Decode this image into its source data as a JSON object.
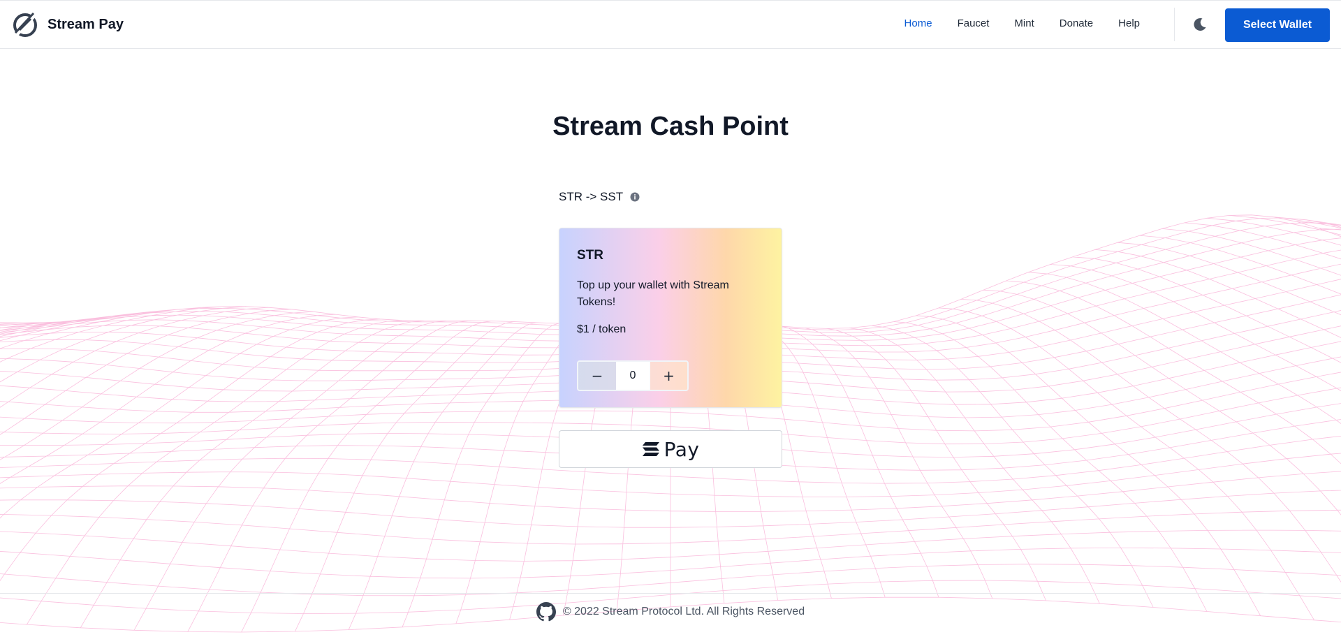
{
  "header": {
    "brand": "Stream Pay",
    "nav": [
      {
        "label": "Home",
        "active": true
      },
      {
        "label": "Faucet",
        "active": false
      },
      {
        "label": "Mint",
        "active": false
      },
      {
        "label": "Donate",
        "active": false
      },
      {
        "label": "Help",
        "active": false
      }
    ],
    "theme_icon": "moon-icon",
    "wallet_button": "Select Wallet"
  },
  "main": {
    "title": "Stream Cash Point",
    "pair_label": "STR -> SST",
    "card": {
      "token": "STR",
      "description": "Top up your wallet with Stream Tokens!",
      "price": "$1 / token",
      "quantity": "0",
      "minus_label": "−",
      "plus_label": "+"
    },
    "pay_button": "Pay"
  },
  "footer": {
    "copyright": "© 2022 Stream Protocol Ltd. All Rights Reserved"
  },
  "colors": {
    "accent": "#0b5bd3",
    "mesh": "#f472b6"
  }
}
